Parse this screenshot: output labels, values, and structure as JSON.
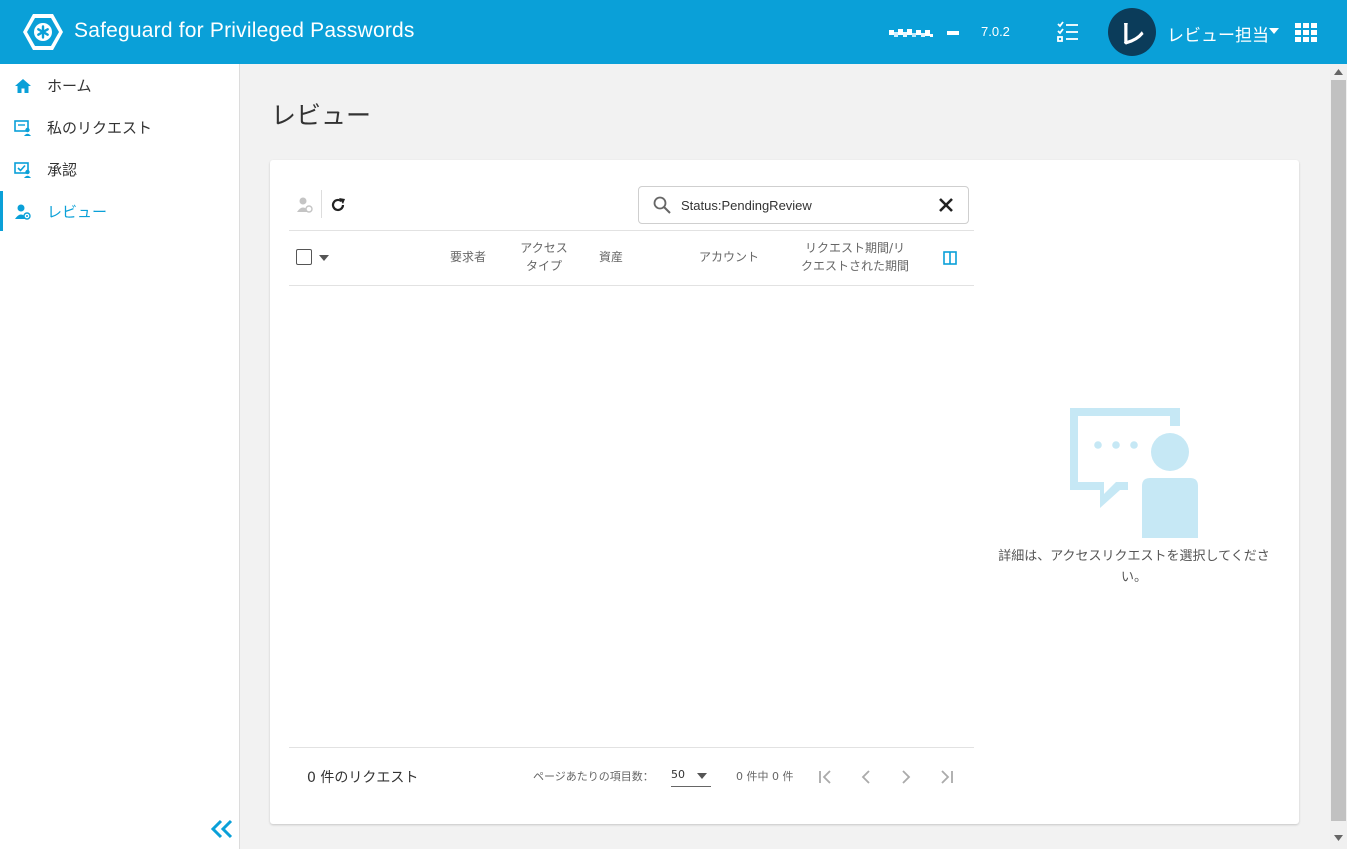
{
  "header": {
    "app_title": "Safeguard for Privileged Passwords",
    "version": "7.0.2",
    "user_initial": "レ",
    "user_name": "レビュー担当",
    "accent_color": "#0aa0d8",
    "avatar_color": "#0b3c5a",
    "icons": [
      "safeguard-logo-icon",
      "tasks-list-icon",
      "caret-down-icon",
      "apps-grid-icon"
    ]
  },
  "sidebar": {
    "items": [
      {
        "label": "ホーム",
        "icon": "home-icon",
        "active": false
      },
      {
        "label": "私のリクエスト",
        "icon": "my-requests-icon",
        "active": false
      },
      {
        "label": "承認",
        "icon": "approval-icon",
        "active": false
      },
      {
        "label": "レビュー",
        "icon": "review-icon",
        "active": true
      }
    ],
    "collapse_icon": "double-chevron-left-icon"
  },
  "main": {
    "page_title": "レビュー",
    "search": {
      "value": "Status:PendingReview",
      "placeholder": ""
    },
    "table": {
      "columns": [
        "要求者",
        "アクセス\nタイプ",
        "資産",
        "アカウント",
        "リクエスト期間/リ\nクエストされた期間"
      ],
      "rows": []
    },
    "footer": {
      "count_label": "0 件のリクエスト",
      "per_page_label": "ページあたりの項目数：",
      "per_page_value": "50",
      "range_label": "0 件中 0 件"
    },
    "empty_detail": {
      "message": "詳細は、アクセスリクエストを選択してください。",
      "illustration": "chat-person-illustration",
      "color": "#c6e8f5"
    }
  }
}
